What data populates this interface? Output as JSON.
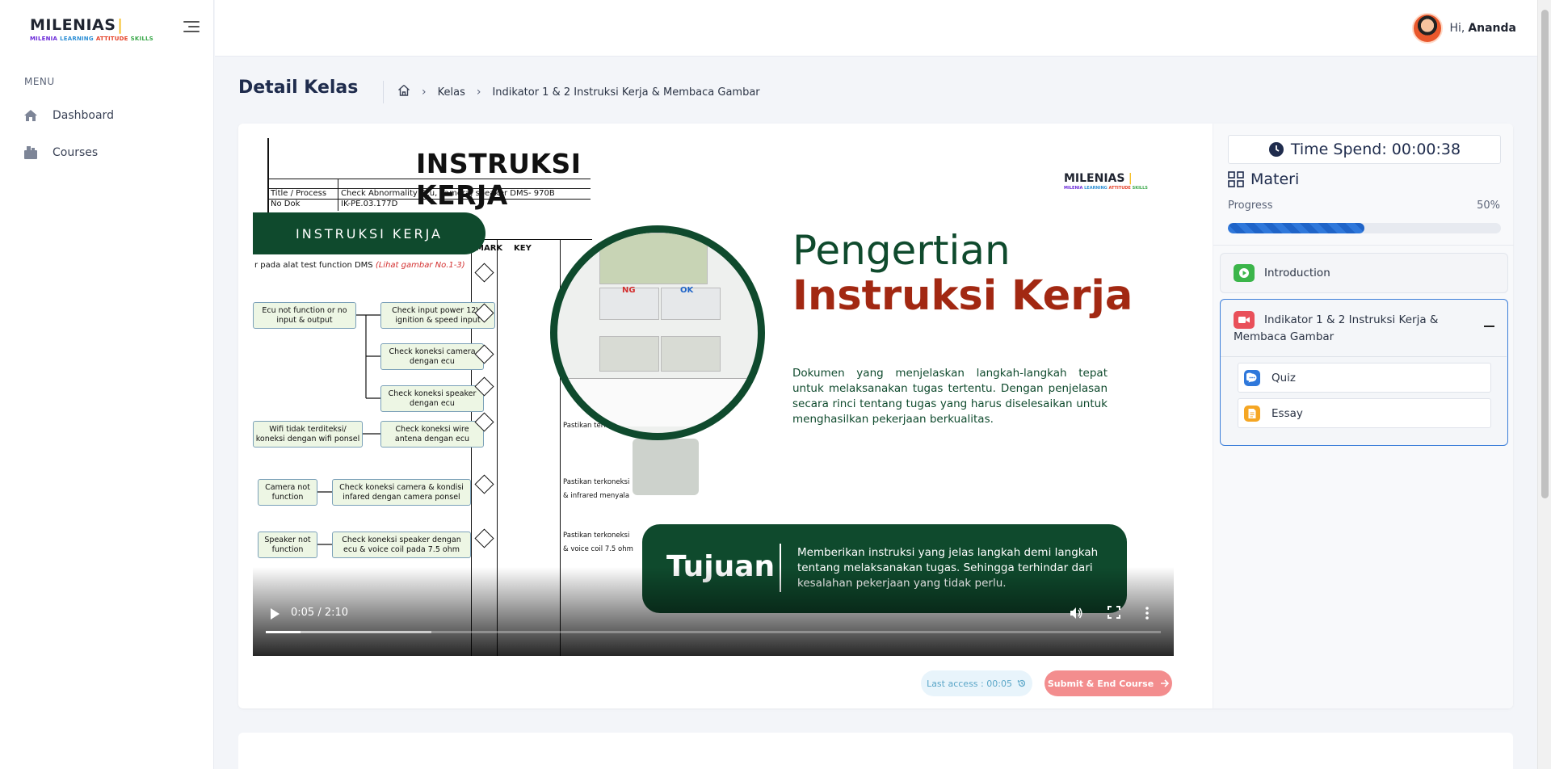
{
  "brand": {
    "name": "MILENIAS",
    "tagline": [
      "MILENIA",
      "LEARNING",
      "ATTITUDE",
      "SKILLS"
    ],
    "tagline_colors": [
      "#6c2bd9",
      "#2d8fd5",
      "#e5432a",
      "#3aa84a"
    ]
  },
  "sidebar": {
    "menu_label": "MENU",
    "items": [
      {
        "label": "Dashboard",
        "icon": "home-icon"
      },
      {
        "label": "Courses",
        "icon": "courses-icon"
      }
    ]
  },
  "header": {
    "greeting": "Hi,",
    "user_name": "Ananda"
  },
  "page": {
    "title": "Detail Kelas",
    "breadcrumb": [
      "Kelas",
      "Indikator 1 & 2 Instruksi Kerja & Membaca Gambar"
    ]
  },
  "video": {
    "slide": {
      "doc_title": "INSTRUKSI KERJA",
      "doc_rows": [
        "Title / Process",
        "Check Abnormality Ecu, camera, speaker DMS- 970B",
        "No Dok",
        "IK-PE.03.177D"
      ],
      "doc_cols": [
        "MARK",
        "KEY"
      ],
      "doc_hint": "r pada alat test function DMS",
      "doc_hint_ref": "(Lihat gambar No.1-3)",
      "pill": "INSTRUKSI KERJA",
      "flow": [
        "Ecu not function or no input & output",
        "Check input power 12V, ignition & speed input",
        "Check koneksi camera dengan ecu",
        "Check koneksi speaker dengan ecu",
        "Wifi tidak terditeksi/ koneksi dengan wifi ponsel",
        "Check koneksi wire antena dengan ecu",
        "Camera not function",
        "Check koneksi camera & kondisi infared dengan camera ponsel",
        "Speaker not function",
        "Check koneksi speaker dengan ecu & voice coil  pada 7.5 ohm"
      ],
      "key_notes": [
        "Pastikan terkoneksi",
        "Pastikan terkoneksi & infrared menyala",
        "Pastikan terkoneksi & voice coil  7.5 ohm"
      ],
      "ng_ok": [
        "NG",
        "OK"
      ],
      "logo": "MILENIAS",
      "heading_1": "Pengertian",
      "heading_2": "Instruksi Kerja",
      "paragraph": "Dokumen yang menjelaskan langkah-langkah tepat untuk melaksanakan tugas tertentu. Dengan penjelasan secara rinci tentang tugas yang harus diselesaikan untuk menghasilkan pekerjaan berkualitas.",
      "tujuan_label": "Tujuan",
      "tujuan_text": "Memberikan instruksi yang jelas langkah demi langkah tentang melaksanakan tugas. Sehingga terhindar dari kesalahan pekerjaan yang tidak perlu."
    },
    "time_display": "0:05 / 2:10",
    "played_fraction": 0.0385,
    "buffered_fraction": 0.185
  },
  "actions": {
    "last_access": "Last access : 00:05",
    "submit": "Submit & End Course"
  },
  "panel": {
    "time_spend": "Time Spend: 00:00:38",
    "materi_label": "Materi",
    "progress_label": "Progress",
    "progress_text": "50%",
    "progress_value": 0.5,
    "items": [
      {
        "label": "Introduction",
        "icon": "play-icon",
        "color": "#3bb54a"
      },
      {
        "label": "Indikator 1 & 2 Instruksi Kerja & Membaca Gambar",
        "icon": "video-icon",
        "color": "#e9505a",
        "expanded": true,
        "children": [
          {
            "label": "Quiz",
            "icon": "quiz-icon",
            "color": "#2f78db"
          },
          {
            "label": "Essay",
            "icon": "essay-icon",
            "color": "#f5a623"
          }
        ]
      }
    ]
  }
}
